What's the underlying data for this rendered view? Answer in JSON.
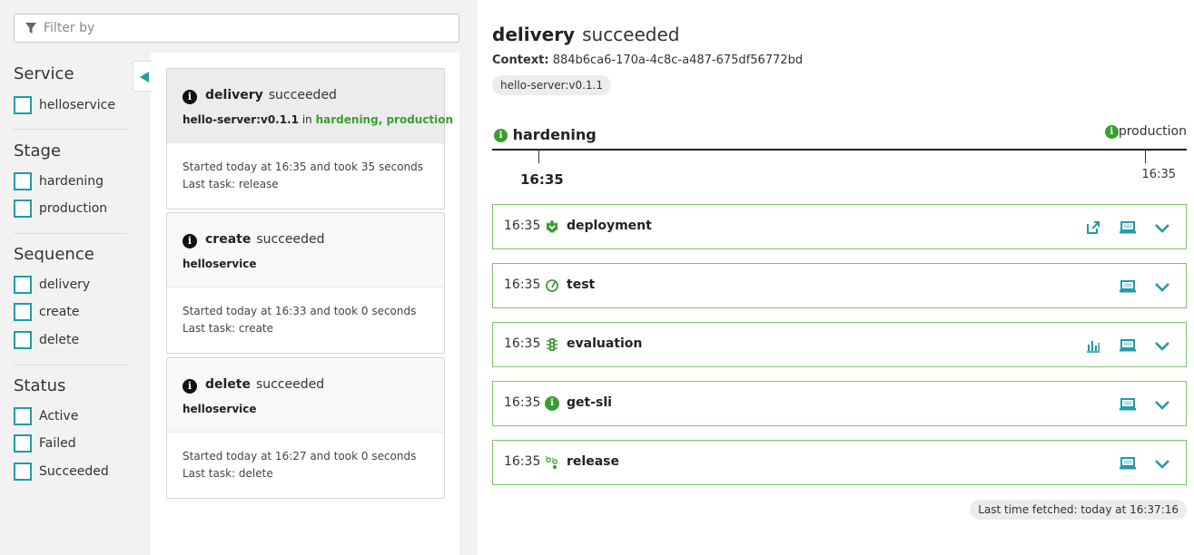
{
  "filter": {
    "placeholder": "Filter by"
  },
  "filters": [
    {
      "title": "Service",
      "options": [
        "helloservice"
      ]
    },
    {
      "title": "Stage",
      "options": [
        "hardening",
        "production"
      ]
    },
    {
      "title": "Sequence",
      "options": [
        "delivery",
        "create",
        "delete"
      ]
    },
    {
      "title": "Status",
      "options": [
        "Active",
        "Failed",
        "Succeeded"
      ]
    }
  ],
  "sequences": [
    {
      "name": "delivery",
      "status": "succeeded",
      "subject": "hello-server:v0.1.1",
      "in_label": "in",
      "stages": [
        "hardening",
        "production"
      ],
      "started": "Started today at 16:35 and took 35 seconds",
      "last_task": "Last task: release"
    },
    {
      "name": "create",
      "status": "succeeded",
      "subject": "helloservice",
      "started": "Started today at 16:33 and took 0 seconds",
      "last_task": "Last task: create"
    },
    {
      "name": "delete",
      "status": "succeeded",
      "subject": "helloservice",
      "started": "Started today at 16:27 and took 0 seconds",
      "last_task": "Last task: delete"
    }
  ],
  "detail": {
    "name": "delivery",
    "status": "succeeded",
    "context_label": "Context:",
    "context_id": "884b6ca6-170a-4c8c-a487-675df56772bd",
    "artifact": "hello-server:v0.1.1",
    "timeline": {
      "stages": [
        {
          "name": "hardening",
          "time": "16:35",
          "active": true
        },
        {
          "name": "production",
          "time": "16:35",
          "active": false
        }
      ]
    },
    "tasks": [
      {
        "time": "16:35",
        "name": "deployment",
        "icon": "deployment-icon",
        "actions": [
          "open-link-icon",
          "laptop-icon",
          "chevron-down-icon"
        ]
      },
      {
        "time": "16:35",
        "name": "test",
        "icon": "test-gauge-icon",
        "actions": [
          "laptop-icon",
          "chevron-down-icon"
        ]
      },
      {
        "time": "16:35",
        "name": "evaluation",
        "icon": "traffic-light-icon",
        "actions": [
          "bar-chart-icon",
          "laptop-icon",
          "chevron-down-icon"
        ]
      },
      {
        "time": "16:35",
        "name": "get-sli",
        "icon": "info-icon",
        "actions": [
          "laptop-icon",
          "chevron-down-icon"
        ]
      },
      {
        "time": "16:35",
        "name": "release",
        "icon": "release-icon",
        "actions": [
          "laptop-icon",
          "chevron-down-icon"
        ]
      }
    ],
    "last_fetched": "Last time fetched: today at 16:37:16"
  },
  "colors": {
    "accent": "#1f9ca8",
    "success": "#3a9e2f",
    "task_border": "#7cc56b",
    "panel_bg": "#f2f2f2"
  }
}
